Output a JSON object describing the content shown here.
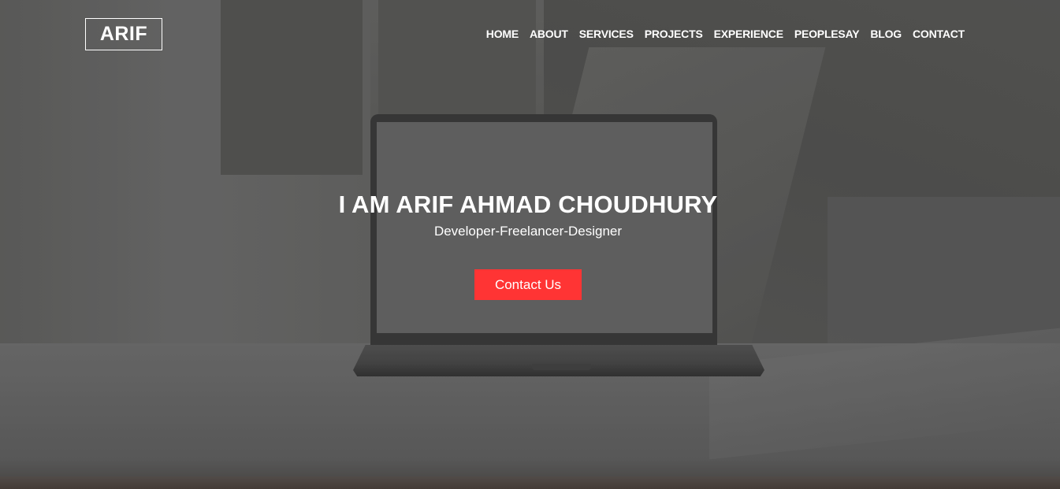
{
  "header": {
    "logo_text": "ARIF",
    "nav_items": [
      "HOME",
      "ABOUT",
      "SERVICES",
      "PROJECTS",
      "EXPERIENCE",
      "PEOPLESAY",
      "BLOG",
      "CONTACT"
    ]
  },
  "hero": {
    "title": "I AM ARIF AHMAD CHOUDHURY",
    "subtitle": "Developer-Freelancer-Designer",
    "cta_label": "Contact Us"
  },
  "colors": {
    "accent": "#ff3434",
    "text": "#ffffff"
  }
}
